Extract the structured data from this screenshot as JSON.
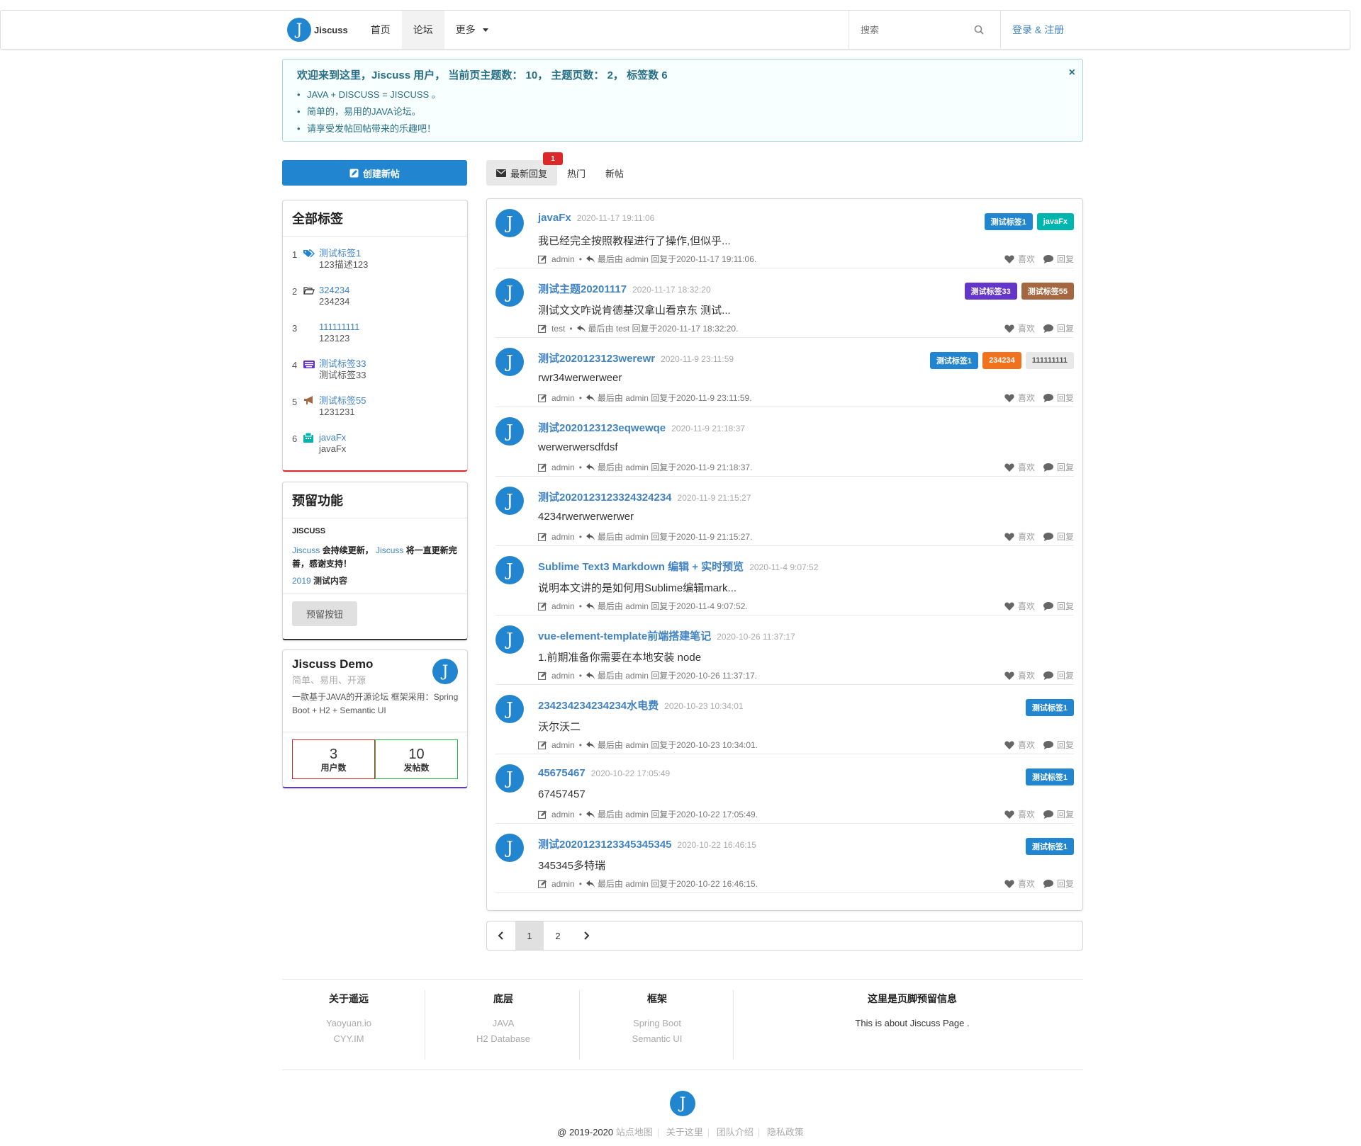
{
  "nav": {
    "brand_initial": "J",
    "brand": "Jiscuss",
    "items": [
      "首页",
      "论坛",
      "更多"
    ],
    "search_placeholder": "搜索",
    "login": "登录 & 注册"
  },
  "welcome": {
    "title": "欢迎来到这里，Jiscuss 用户， 当前页主题数： 10， 主题页数： 2， 标签数 6",
    "items": [
      "JAVA + DISCUSS = JISCUSS 。",
      "简单的，易用的JAVA论坛。",
      "请享受发帖回帖带来的乐趣吧！"
    ],
    "close": "×"
  },
  "create_button": "创建新帖",
  "tags_card": {
    "title": "全部标签",
    "items": [
      {
        "num": "1",
        "name": "测试标签1",
        "desc": "123描述123",
        "icon": "tags-icon",
        "color": "#2185d0"
      },
      {
        "num": "2",
        "name": "324234",
        "desc": "234234",
        "icon": "folder-open-icon",
        "color": "#333"
      },
      {
        "num": "3",
        "name": "111111111",
        "desc": "123123",
        "icon": "",
        "color": "#333"
      },
      {
        "num": "4",
        "name": "测试标签33",
        "desc": "测试标签33",
        "icon": "keyboard-icon",
        "color": "#6435c9"
      },
      {
        "num": "5",
        "name": "测试标签55",
        "desc": "1231231",
        "icon": "bullhorn-icon",
        "color": "#a5673f"
      },
      {
        "num": "6",
        "name": "javaFx",
        "desc": "javaFx",
        "icon": "fax-icon",
        "color": "#00b5ad"
      }
    ]
  },
  "reserved_card": {
    "title": "预留功能",
    "small_title": "JISCUSS",
    "line1_a": "Jiscuss",
    "line1_b": "会持续更新，",
    "line1_c": "Jiscuss",
    "line1_d": "将一直更新完善，感谢支持！",
    "line2_a": "2019",
    "line2_b": "测试内容",
    "button": "预留按钮"
  },
  "demo_card": {
    "title": "Jiscuss Demo",
    "subtitle": "简单、易用、开源",
    "desc": "一款基于JAVA的开源论坛 框架采用：Spring Boot + H2 + Semantic UI",
    "stats": [
      {
        "value": "3",
        "label": "用户数"
      },
      {
        "value": "10",
        "label": "发帖数"
      }
    ]
  },
  "tabs": [
    {
      "label": "最新回复",
      "badge": "1"
    },
    {
      "label": "热门"
    },
    {
      "label": "新帖"
    }
  ],
  "posts": [
    {
      "title": "javaFx",
      "time": "2020-11-17 19:11:06",
      "excerpt": "我已经完全按照教程进行了操作,但似乎...",
      "author": "admin",
      "reply_info": "最后由 admin 回复于2020-11-17 19:11:06.",
      "tags": [
        {
          "label": "测试标签1",
          "color": "#2185d0"
        },
        {
          "label": "javaFx",
          "color": "#00b5ad"
        }
      ]
    },
    {
      "title": "测试主题20201117",
      "time": "2020-11-17 18:32:20",
      "excerpt": "测试文文咋说肯德基汉拿山看京东 测试...",
      "author": "test",
      "reply_info": "最后由 test 回复于2020-11-17 18:32:20.",
      "tags": [
        {
          "label": "测试标签33",
          "color": "#6435c9"
        },
        {
          "label": "测试标签55",
          "color": "#a5673f"
        }
      ]
    },
    {
      "title": "测试2020123123werewr",
      "time": "2020-11-9 23:11:59",
      "excerpt": "rwr34werwerweer",
      "author": "admin",
      "reply_info": "最后由 admin 回复于2020-11-9 23:11:59.",
      "tags": [
        {
          "label": "测试标签1",
          "color": "#2185d0"
        },
        {
          "label": "234234",
          "color": "#f2711c"
        },
        {
          "label": "111111111",
          "color": "#e8e8e8"
        }
      ]
    },
    {
      "title": "测试2020123123eqwewqe",
      "time": "2020-11-9 21:18:37",
      "excerpt": "werwerwersdfdsf",
      "author": "admin",
      "reply_info": "最后由 admin 回复于2020-11-9 21:18:37.",
      "tags": []
    },
    {
      "title": "测试2020123123324324234",
      "time": "2020-11-9 21:15:27",
      "excerpt": "4234rwerwerwerwer",
      "author": "admin",
      "reply_info": "最后由 admin 回复于2020-11-9 21:15:27.",
      "tags": []
    },
    {
      "title": "Sublime Text3 Markdown 编辑 + 实时预览",
      "time": "2020-11-4 9:07:52",
      "excerpt": "说明本文讲的是如何用Sublime编辑mark...",
      "author": "admin",
      "reply_info": "最后由 admin 回复于2020-11-4 9:07:52.",
      "tags": []
    },
    {
      "title": "vue-element-template前端搭建笔记",
      "time": "2020-10-26 11:37:17",
      "excerpt": "1.前期准备你需要在本地安装 node",
      "author": "admin",
      "reply_info": "最后由 admin 回复于2020-10-26 11:37:17.",
      "tags": []
    },
    {
      "title": "234234234234234水电费",
      "time": "2020-10-23 10:34:01",
      "excerpt": "沃尔沃二",
      "author": "admin",
      "reply_info": "最后由 admin 回复于2020-10-23 10:34:01.",
      "tags": [
        {
          "label": "测试标签1",
          "color": "#2185d0"
        }
      ]
    },
    {
      "title": "45675467",
      "time": "2020-10-22 17:05:49",
      "excerpt": "67457457",
      "author": "admin",
      "reply_info": "最后由 admin 回复于2020-10-22 17:05:49.",
      "tags": [
        {
          "label": "测试标签1",
          "color": "#2185d0"
        }
      ]
    },
    {
      "title": "测试2020123123345345345",
      "time": "2020-10-22 16:46:15",
      "excerpt": "345345多特瑞",
      "author": "admin",
      "reply_info": "最后由 admin 回复于2020-10-22 16:46:15.",
      "tags": [
        {
          "label": "测试标签1",
          "color": "#2185d0"
        }
      ]
    }
  ],
  "post_actions": {
    "like": "喜欢",
    "reply": "回复"
  },
  "pagination": {
    "pages": [
      "1",
      "2"
    ],
    "current": "1"
  },
  "footer": {
    "columns": [
      {
        "title": "关于遥远",
        "items": [
          "Yaoyuan.io",
          "CYY.IM"
        ]
      },
      {
        "title": "底层",
        "items": [
          "JAVA",
          "H2 Database"
        ]
      },
      {
        "title": "框架",
        "items": [
          "Spring Boot",
          "Semantic UI"
        ]
      }
    ],
    "info_title": "这里是页脚预留信息",
    "info_text": "This is about Jiscuss Page .",
    "copyright": "@ 2019-2020",
    "links": [
      "站点地图",
      "关于这里",
      "团队介绍",
      "隐私政策"
    ]
  }
}
